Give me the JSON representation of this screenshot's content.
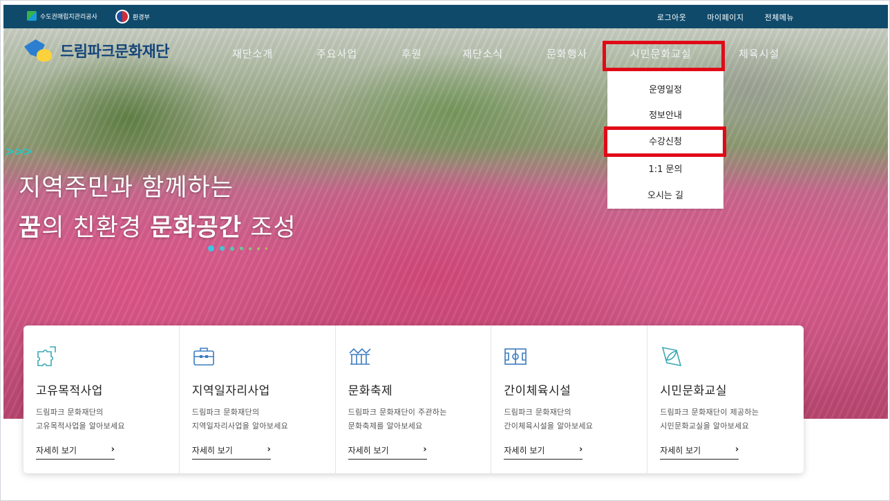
{
  "topbar": {
    "gov_logo_1": "수도권매립지관리공사",
    "gov_logo_2": "환경부",
    "links": [
      "로그아웃",
      "마이페이지",
      "전체메뉴"
    ]
  },
  "brand": {
    "name": "드림파크문화재단"
  },
  "nav": {
    "items": [
      "재단소개",
      "주요사업",
      "후원",
      "재단소식",
      "문화행사",
      "시민문화교실",
      "체육시설"
    ],
    "active": "시민문화교실"
  },
  "dropdown": {
    "items": [
      "운영일정",
      "정보안내",
      "수강신청",
      "1:1 문의",
      "오시는 길"
    ],
    "highlighted": "수강신청"
  },
  "hero": {
    "arrows": ">>>",
    "line1": "지역주민과 함께하는",
    "line2_part1": "꿈",
    "line2_part2": "의 친환경 ",
    "line2_part3": "문화공간",
    "line2_part4": " 조성"
  },
  "cards": [
    {
      "icon": "puzzle-icon",
      "title": "고유목적사업",
      "desc": "드림파크 문화재단의\n고유목적사업을 알아보세요",
      "more": "자세히 보기"
    },
    {
      "icon": "briefcase-icon",
      "title": "지역일자리사업",
      "desc": "드림파크 문화재단의\n지역일자리사업을 알아보세요",
      "more": "자세히 보기"
    },
    {
      "icon": "festival-tent-icon",
      "title": "문화축제",
      "desc": "드림파크 문화재단이 주관하는\n문화축제를 알아보세요",
      "more": "자세히 보기"
    },
    {
      "icon": "soccer-field-icon",
      "title": "간이체육시설",
      "desc": "드림파크 문화재단의\n간이체육시설을 알아보세요",
      "more": "자세히 보기"
    },
    {
      "icon": "leaf-book-icon",
      "title": "시민문화교실",
      "desc": "드림파크 문화재단이 제공하는\n시민문화교실을 알아보세요",
      "more": "자세히 보기"
    }
  ],
  "colors": {
    "topbar": "#0f4a6b",
    "highlight": "#e00a17",
    "brand_text": "#15457a",
    "accent_teal": "#2bc5c0"
  }
}
